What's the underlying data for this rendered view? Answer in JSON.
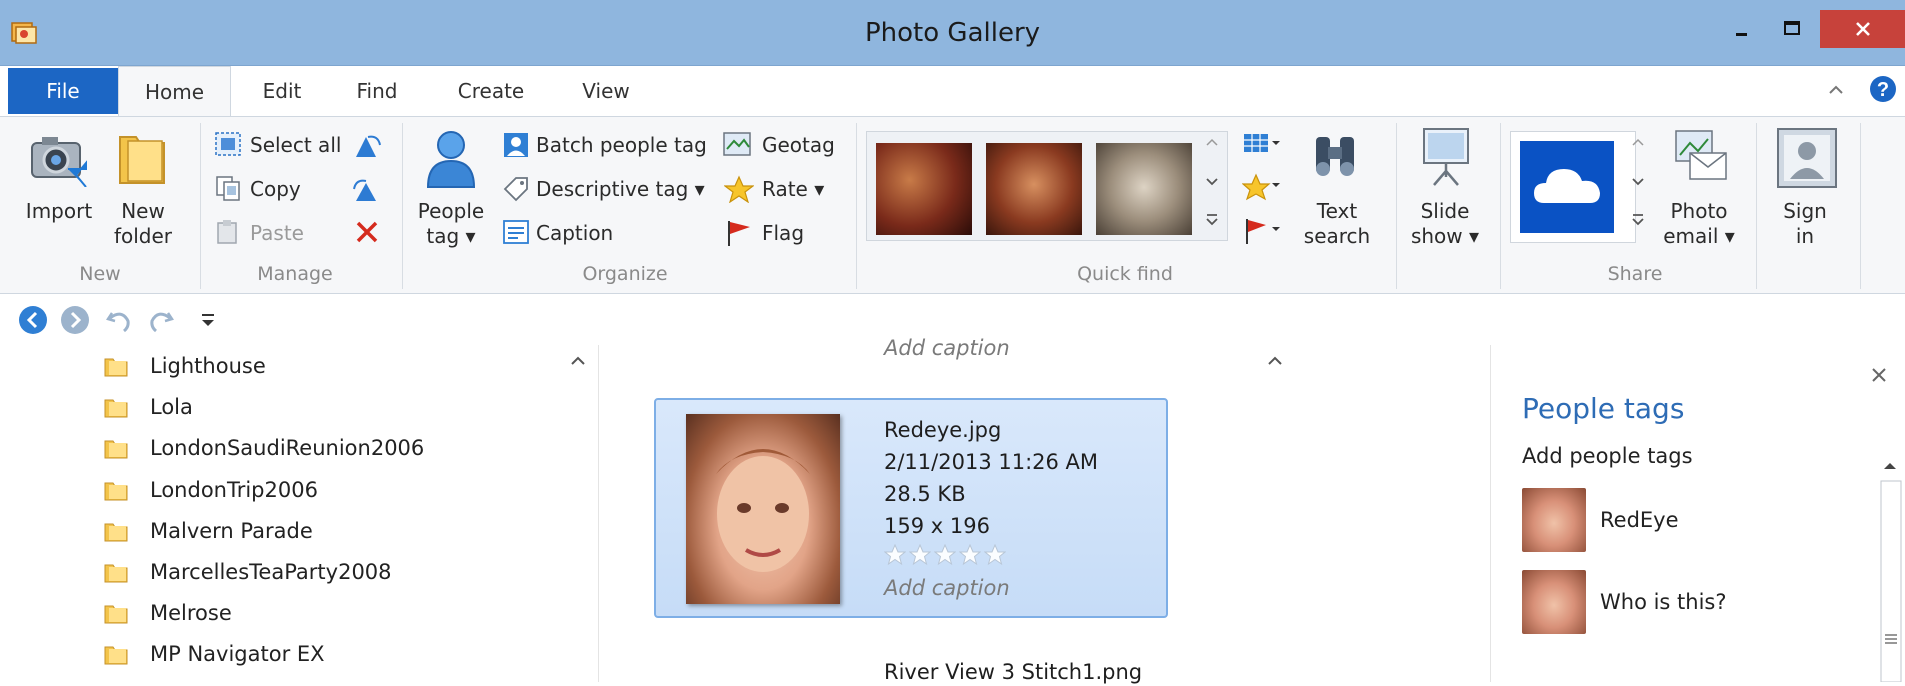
{
  "window": {
    "title": "Photo Gallery"
  },
  "tabs": [
    "File",
    "Home",
    "Edit",
    "Find",
    "Create",
    "View"
  ],
  "ribbon": {
    "new_group": {
      "label": "New",
      "import": "Import",
      "new_folder_1": "New",
      "new_folder_2": "folder"
    },
    "manage_group": {
      "label": "Manage",
      "select_all": "Select all",
      "copy": "Copy",
      "paste": "Paste"
    },
    "organize_group": {
      "label": "Organize",
      "people_tag_1": "People",
      "people_tag_2": "tag",
      "batch_people_tag": "Batch people tag",
      "descriptive_tag": "Descriptive tag",
      "caption": "Caption",
      "geotag": "Geotag",
      "rate": "Rate",
      "flag": "Flag"
    },
    "quickfind_group": {
      "label": "Quick find",
      "text_search_1": "Text",
      "text_search_2": "search"
    },
    "slideshow": {
      "line1": "Slide",
      "line2": "show"
    },
    "share_group": {
      "label": "Share",
      "photo_email_1": "Photo",
      "photo_email_2": "email"
    },
    "sign_in": {
      "line1": "Sign",
      "line2": "in"
    }
  },
  "folders": [
    "Lighthouse",
    "Lola",
    "LondonSaudiReunion2006",
    "LondonTrip2006",
    "Malvern Parade",
    "MarcellesTeaParty2008",
    "Melrose",
    "MP Navigator EX"
  ],
  "gallery": {
    "prev_caption": "Add caption",
    "selected": {
      "filename": "Redeye.jpg",
      "date": "2/11/2013 11:26 AM",
      "size": "28.5 KB",
      "dimensions": "159 x 196",
      "rating": 0,
      "caption": "Add caption"
    },
    "next_filename": "River View 3 Stitch1.png"
  },
  "people_pane": {
    "title": "People tags",
    "add": "Add people tags",
    "people": [
      "RedEye",
      "Who is this?"
    ]
  },
  "colors": {
    "file_tab": "#1c66c4",
    "titlebar": "#8fb6de",
    "close": "#c7423b",
    "accent": "#2e6cb5"
  }
}
